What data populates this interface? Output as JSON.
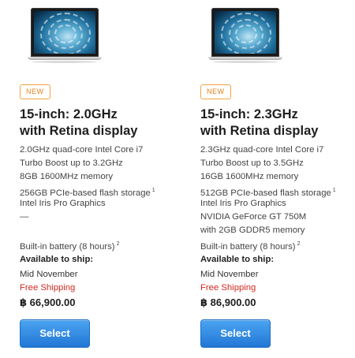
{
  "products": [
    {
      "badge": "NEW",
      "title_line1": "15-inch: 2.0GHz",
      "title_line2": "with Retina display",
      "specs": [
        "2.0GHz quad-core Intel Core i7",
        "Turbo Boost up to 3.2GHz",
        "8GB 1600MHz memory",
        "256GB PCIe-based flash storage",
        "Intel Iris Pro Graphics",
        "—",
        "",
        "Built-in battery (8 hours)"
      ],
      "storage_footnote": "1",
      "battery_footnote": "2",
      "availability_label": "Available to ship:",
      "availability_value": "Mid November",
      "shipping": "Free Shipping",
      "price": "฿ 66,900.00",
      "select_label": "Select"
    },
    {
      "badge": "NEW",
      "title_line1": "15-inch: 2.3GHz",
      "title_line2": "with Retina display",
      "specs": [
        "2.3GHz quad-core Intel Core i7",
        "Turbo Boost up to 3.5GHz",
        "16GB 1600MHz memory",
        "512GB PCIe-based flash storage",
        "Intel Iris Pro Graphics",
        "NVIDIA GeForce GT 750M",
        "with 2GB GDDR5 memory",
        "Built-in battery (8 hours)"
      ],
      "storage_footnote": "1",
      "battery_footnote": "2",
      "availability_label": "Available to ship:",
      "availability_value": "Mid November",
      "shipping": "Free Shipping",
      "price": "฿ 86,900.00",
      "select_label": "Select"
    }
  ],
  "colors": {
    "badge": "#e2801c",
    "shipping": "#d4291f",
    "button": "#2b83e0"
  }
}
